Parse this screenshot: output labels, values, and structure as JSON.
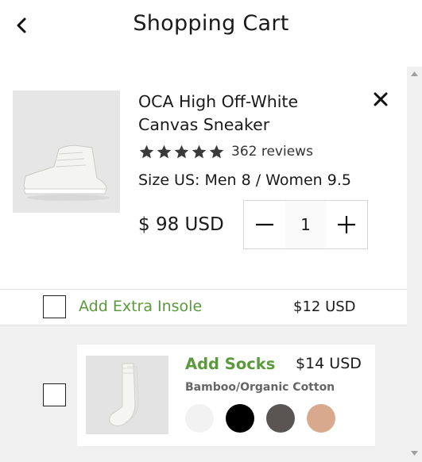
{
  "header": {
    "title": "Shopping Cart",
    "back_icon": "chevron-left-icon"
  },
  "cart_item": {
    "name_line1": "OCA High Off-White",
    "name_line2": "Canvas Sneaker",
    "rating": 5,
    "reviews": "362 reviews",
    "size": "Size US: Men 8 / Women 9.5",
    "price": "$ 98 USD",
    "quantity": "1",
    "remove_icon": "close-icon"
  },
  "insole_addon": {
    "label": "Add Extra Insole",
    "price": "$12 USD",
    "checked": false
  },
  "socks_addon": {
    "label": "Add Socks",
    "price": "$14 USD",
    "material": "Bamboo/Organic Cotton",
    "checked": false,
    "swatches": [
      {
        "name": "white",
        "color": "#f2f2f2"
      },
      {
        "name": "black",
        "color": "#000000"
      },
      {
        "name": "charcoal",
        "color": "#5a5552"
      },
      {
        "name": "peach",
        "color": "#d9a98d"
      }
    ]
  },
  "colors": {
    "accent_green": "#5a9a3c",
    "background": "#f0f0f0"
  }
}
